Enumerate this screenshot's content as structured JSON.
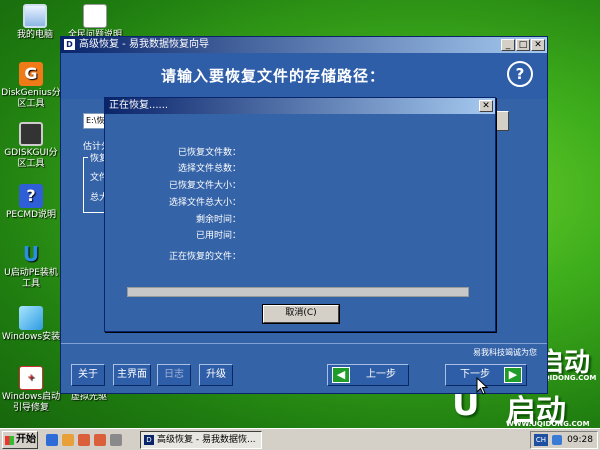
{
  "desktop": {
    "icons": [
      {
        "label": "我的电脑",
        "icon": "computer-icon"
      },
      {
        "label": "全民问题说明",
        "icon": "document-icon"
      },
      {
        "label": "DiskGenius分区工具",
        "icon": "diskgenius-icon"
      },
      {
        "label": "GDISKGUI分区工具",
        "icon": "gdiskgui-icon"
      },
      {
        "label": "PECMD说明",
        "icon": "help-icon"
      },
      {
        "label": "U启动PE装机工具",
        "icon": "u-launcher-icon"
      },
      {
        "label": "Windows安装",
        "icon": "windows-setup-icon"
      },
      {
        "label": "Windows启动引导修复",
        "icon": "boot-repair-icon"
      },
      {
        "label": "虚拟光驱",
        "icon": "virtual-drive-icon"
      }
    ],
    "brand_top": "启动",
    "brand_top_sub": "UQIDONG.COM",
    "brand_bottom": "启动",
    "brand_bottom_sub": "WWW.UQIDONG.COM"
  },
  "main_window": {
    "title": "高级恢复 - 易我数据恢复向导",
    "header": "请输入要恢复文件的存储路径：",
    "path_value": "E:\\恢",
    "estimate_label": "估计分",
    "group_title": "恢复",
    "group_lines": [
      "文件",
      "总大"
    ],
    "site_note": "易我科技竭诚为您",
    "buttons": {
      "about": "关于",
      "home": "主界面",
      "log": "日志",
      "upgrade": "升级",
      "prev": "上一步",
      "next": "下一步"
    }
  },
  "progress_dialog": {
    "title": "正在恢复......",
    "rows": [
      "已恢复文件数：",
      "选择文件总数：",
      "已恢复文件大小：",
      "选择文件总大小：",
      "剩余时间：",
      "已用时间：",
      "正在恢复的文件："
    ],
    "progress_fraction": 0,
    "cancel_label": "取消(C)"
  },
  "taskbar": {
    "start_label": "开始",
    "task_title": "高级恢复 - 易我数据恢...",
    "language": "CH",
    "clock": "09:28"
  }
}
